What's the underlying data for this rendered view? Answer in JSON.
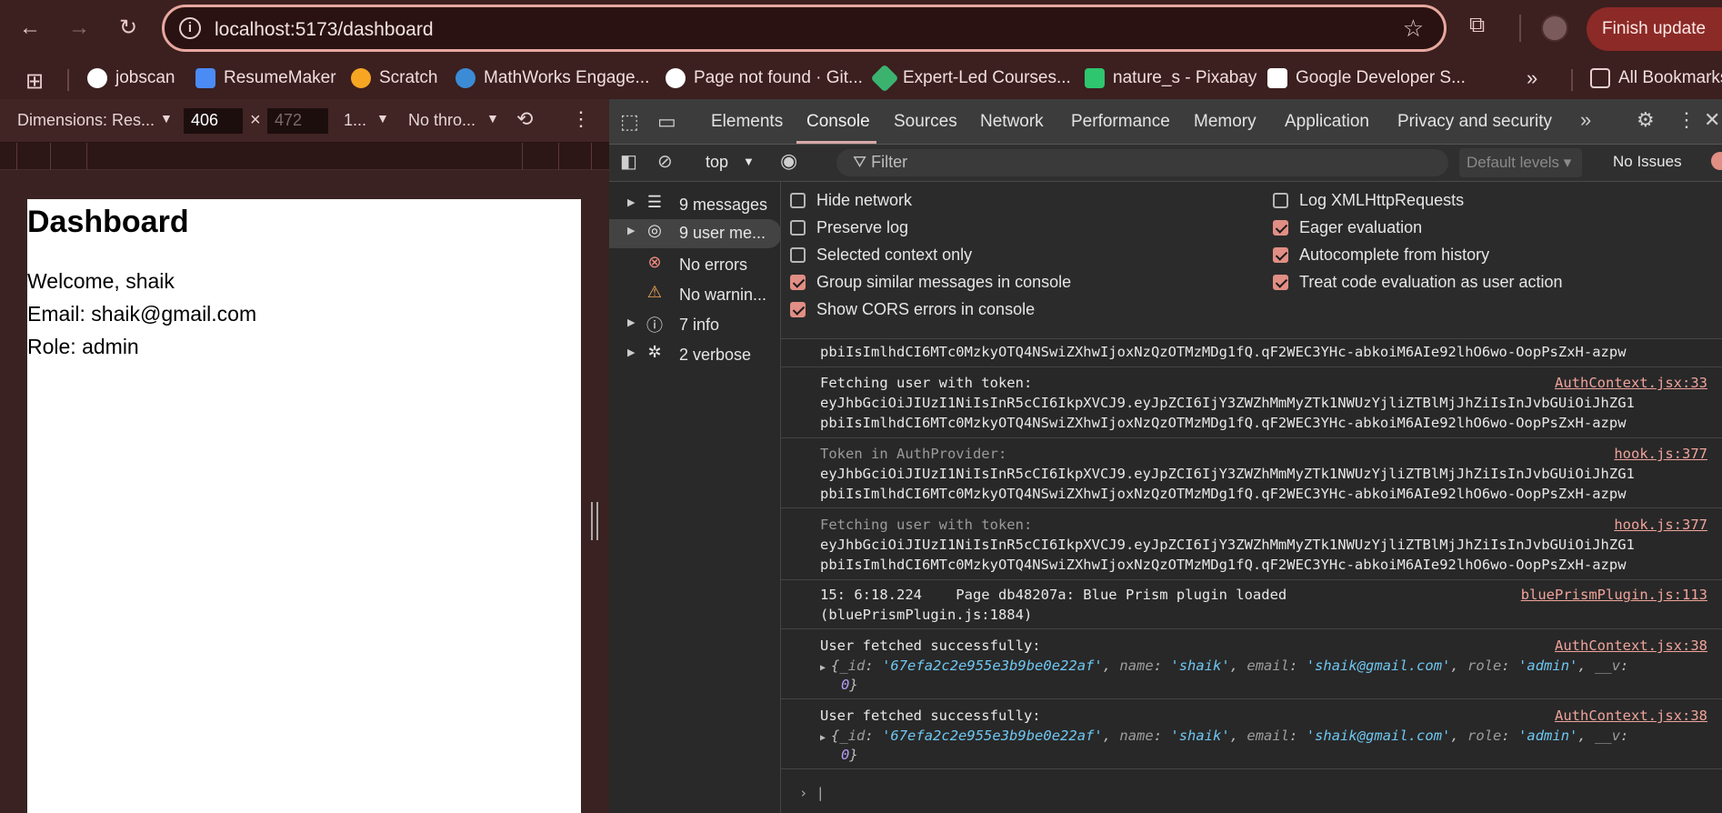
{
  "browser": {
    "url": "localhost:5173/dashboard",
    "finish_update": "Finish update",
    "bookmarks": [
      {
        "label": "jobscan",
        "color": "#ffffff"
      },
      {
        "label": "ResumeMaker",
        "color": "#4b8bf5"
      },
      {
        "label": "Scratch",
        "color": "#f6a623"
      },
      {
        "label": "MathWorks Engage...",
        "color": "#3b8bd6"
      },
      {
        "label": "Page not found · Git...",
        "color": "#ffffff"
      },
      {
        "label": "Expert-Led Courses...",
        "color": "#3bb36f"
      },
      {
        "label": "nature_s - Pixabay",
        "color": "#2ec66e"
      },
      {
        "label": "Google Developer S...",
        "color": "#ffffff"
      }
    ],
    "all_bookmarks": "All Bookmarks",
    "more_bookmarks": "»"
  },
  "device_toolbar": {
    "dimensions_label": "Dimensions: Res...",
    "width": "406",
    "height": "472",
    "zoom": "1...",
    "throttle": "No thro..."
  },
  "page": {
    "title": "Dashboard",
    "welcome": "Welcome, shaik",
    "email": "Email: shaik@gmail.com",
    "role": "Role: admin"
  },
  "devtools": {
    "tabs": [
      "Elements",
      "Console",
      "Sources",
      "Network",
      "Performance",
      "Memory",
      "Application",
      "Privacy and security"
    ],
    "active_tab": "Console",
    "context": "top",
    "filter_placeholder": "Filter",
    "levels": "Default levels",
    "issues": "No Issues",
    "sidebar": [
      {
        "label": "9 messages",
        "icon": "list-icon",
        "arrow": true
      },
      {
        "label": "9 user me...",
        "icon": "user-icon",
        "arrow": true,
        "selected": true
      },
      {
        "label": "No errors",
        "icon": "error-icon",
        "arrow": false
      },
      {
        "label": "No warnin...",
        "icon": "warning-icon",
        "arrow": false
      },
      {
        "label": "7 info",
        "icon": "info-icon",
        "arrow": true
      },
      {
        "label": "2 verbose",
        "icon": "bug-icon",
        "arrow": true
      }
    ],
    "settings_left": [
      {
        "label": "Hide network",
        "checked": false
      },
      {
        "label": "Preserve log",
        "checked": false
      },
      {
        "label": "Selected context only",
        "checked": false
      },
      {
        "label": "Group similar messages in console",
        "checked": true
      },
      {
        "label": "Show CORS errors in console",
        "checked": true
      }
    ],
    "settings_right": [
      {
        "label": "Log XMLHttpRequests",
        "checked": false
      },
      {
        "label": "Eager evaluation",
        "checked": true
      },
      {
        "label": "Autocomplete from history",
        "checked": true
      },
      {
        "label": "Treat code evaluation as user action",
        "checked": true
      }
    ],
    "console": {
      "token_line1": "eyJhbGciOiJIUzI1NiIsInR5cCI6IkpXVCJ9.eyJpZCI6IjY3ZWZhMmMyZTk1NWUzYjliZTBlMjJhZiIsInJvbGUiOiJhZG1",
      "token_line2": "pbiIsImlhdCI6MTc0MzkyOTQ4NSwiZXhwIjoxNzQzOTMzMDg1fQ.qF2WEC3YHc-abkoiM6AIe92lhO6wo-OopPsZxH-azpw",
      "fetching": "Fetching user with token:",
      "token_in_provider": "Token in AuthProvider:",
      "src_auth33": "AuthContext.jsx:33",
      "src_hook": "hook.js:377",
      "src_blueprism": "bluePrismPlugin.js:113",
      "src_auth38": "AuthContext.jsx:38",
      "blueprism_line1": "15: 6:18.224    Page db48207a: Blue Prism plugin loaded",
      "blueprism_line2": "(bluePrismPlugin.js:1884)",
      "fetched": "User fetched successfully:",
      "obj_id_key": "_id",
      "obj_id": "'67efa2c2e955e3b9be0e22af'",
      "obj_name_key": "name",
      "obj_name": "'shaik'",
      "obj_email_key": "email",
      "obj_email": "'shaik@gmail.com'",
      "obj_role_key": "role",
      "obj_role": "'admin'",
      "obj_v_key": "__v",
      "obj_v": "0"
    }
  }
}
